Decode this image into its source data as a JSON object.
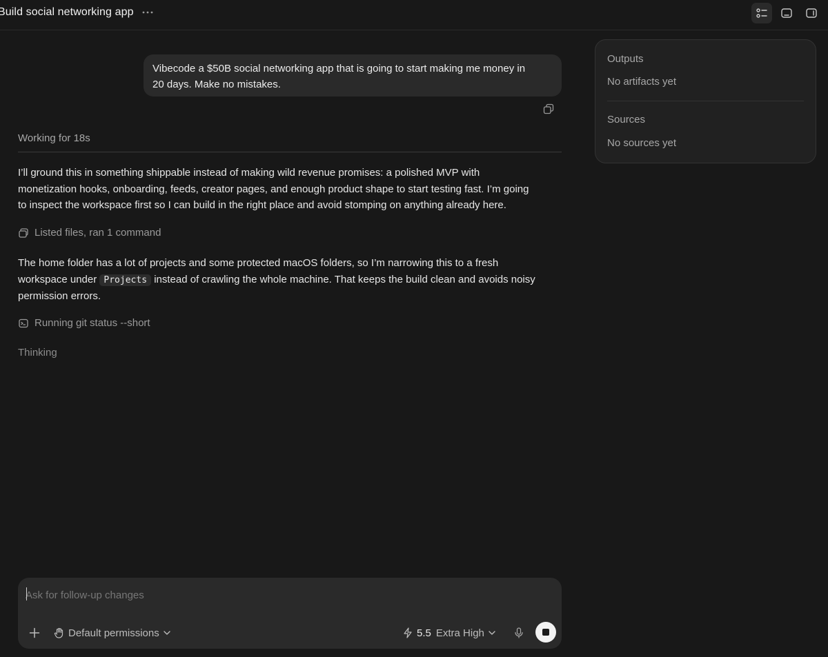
{
  "header": {
    "title": "Build social networking app",
    "more_icon": "ellipsis-icon",
    "icons": [
      "task-list-icon",
      "terminal-panel-icon",
      "sidebar-icon"
    ]
  },
  "panel": {
    "outputs_title": "Outputs",
    "outputs_empty": "No artifacts yet",
    "sources_title": "Sources",
    "sources_empty": "No sources yet"
  },
  "conversation": {
    "user_message_line1": "Vibecode a $50B social networking app that is going to start making me money in",
    "user_message_line2": "20 days. Make no mistakes.",
    "copy_icon": "copy-icon",
    "working_label": "Working for 18s",
    "para1_line1": "I’ll ground this in something shippable instead of making wild revenue promises: a polished MVP with",
    "para1_line2": "monetization hooks, onboarding, feeds, creator pages, and enough product shape to start testing fast. I’m going",
    "para1_line3": "to inspect the workspace first so I can build in the right place and avoid stomping on anything already here.",
    "step1_label": "Listed files, ran 1 command",
    "para2_line1": "The home folder has a lot of projects and some protected macOS folders, so I’m narrowing this to a fresh",
    "para2_line2_before": "workspace under",
    "para2_code": "Projects",
    "para2_line2_after": "instead of crawling the whole machine. That keeps the build clean and avoids noisy",
    "para2_line3": "permission errors.",
    "step2_label": "Running git status --short",
    "thinking_label": "Thinking"
  },
  "composer": {
    "placeholder": "Ask for follow-up changes",
    "value": "",
    "permissions_label": "Default permissions",
    "model_version": "5.5",
    "model_effort": "Extra High"
  },
  "colors": {
    "background": "#181818",
    "bubble": "#2a2a2a",
    "panel": "#212121",
    "muted_text": "#a8a8a8",
    "stop_button": "#f2f2f2"
  }
}
